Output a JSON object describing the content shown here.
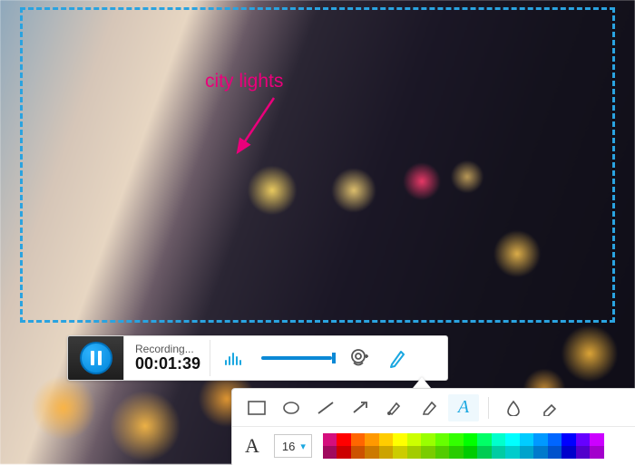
{
  "annotation": {
    "text": "city lights",
    "color": "#ea007b"
  },
  "recording_bar": {
    "status": "Recording...",
    "elapsed": "00:01:39"
  },
  "tools": {
    "items": [
      {
        "name": "rectangle-tool",
        "active": false
      },
      {
        "name": "ellipse-tool",
        "active": false
      },
      {
        "name": "line-tool",
        "active": false
      },
      {
        "name": "arrow-tool",
        "active": false
      },
      {
        "name": "brush-tool",
        "active": false
      },
      {
        "name": "highlighter-tool",
        "active": false
      },
      {
        "name": "text-tool",
        "active": true
      },
      {
        "name": "divider"
      },
      {
        "name": "blur-tool",
        "active": false
      },
      {
        "name": "eraser-tool",
        "active": false
      }
    ]
  },
  "font": {
    "sample_glyph": "A",
    "size": "16"
  },
  "palette": {
    "colors": [
      "#d40f7d",
      "#ff0000",
      "#ff6600",
      "#ff9900",
      "#ffcc00",
      "#ffff00",
      "#ccff00",
      "#99ff00",
      "#66ff00",
      "#33ff00",
      "#00ff00",
      "#00ff66",
      "#00ffcc",
      "#00ffff",
      "#00ccff",
      "#0099ff",
      "#0066ff",
      "#0000ff",
      "#6600ff",
      "#cc00ff",
      "#a00a5e",
      "#cc0000",
      "#cc5200",
      "#cc7a00",
      "#cca300",
      "#cccc00",
      "#a3cc00",
      "#7acc00",
      "#52cc00",
      "#29cc00",
      "#00cc00",
      "#00cc52",
      "#00cca3",
      "#00cccc",
      "#00a3cc",
      "#007acc",
      "#0052cc",
      "#0000cc",
      "#5200cc",
      "#a300cc"
    ]
  }
}
